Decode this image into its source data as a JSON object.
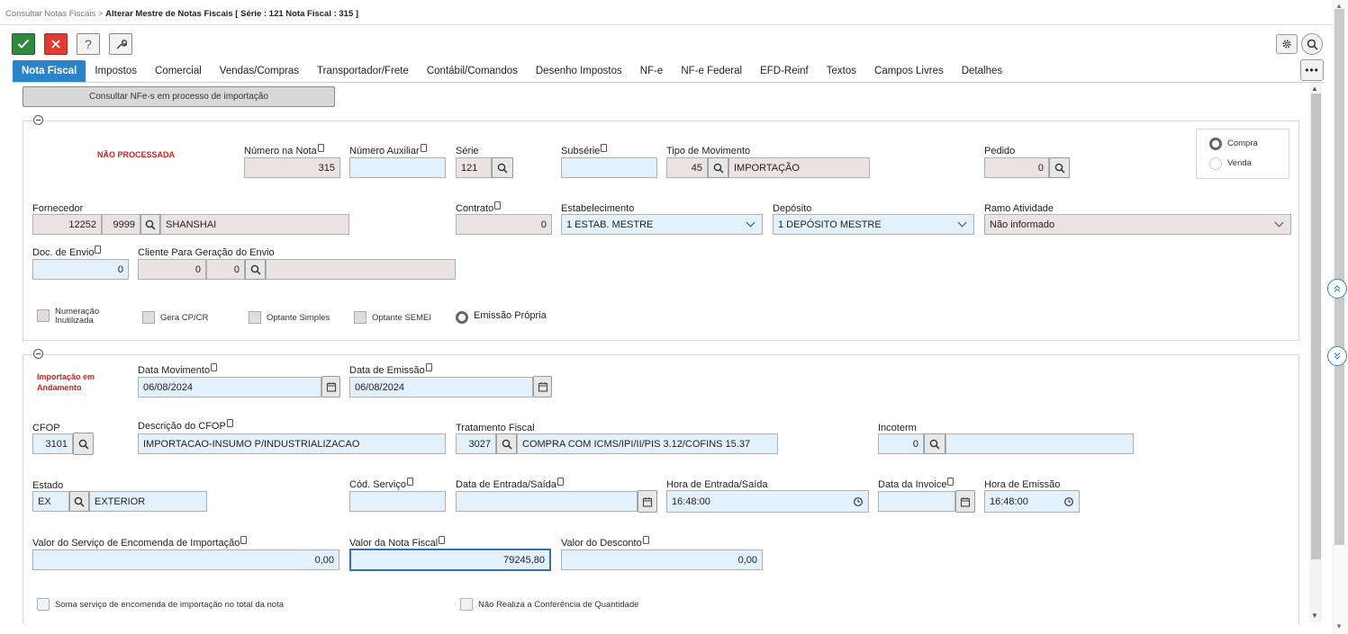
{
  "breadcrumb": {
    "parent": "Consultar Notas Fiscais",
    "separator": ">",
    "current": "Alterar Mestre de Notas Fiscais [ Série : 121 Nota Fiscal : 315 ]"
  },
  "toolbar": {
    "help_label": "?"
  },
  "tabs": [
    "Nota Fiscal",
    "Impostos",
    "Comercial",
    "Vendas/Compras",
    "Transportador/Frete",
    "Contábil/Comandos",
    "Desenho Impostos",
    "NF-e",
    "NF-e Federal",
    "EFD-Reinf",
    "Textos",
    "Campos Livres",
    "Detalhes"
  ],
  "consult_button": "Consultar NFe-s em processo de importação",
  "section1": {
    "status": "NÃO PROCESSADA",
    "numero_nota": {
      "label": "Número na Nota",
      "value": "315"
    },
    "numero_auxiliar": {
      "label": "Número Auxiliar",
      "value": ""
    },
    "serie": {
      "label": "Série",
      "value": "121"
    },
    "subserie": {
      "label": "Subsérie",
      "value": ""
    },
    "tipo_movimento": {
      "label": "Tipo de Movimento",
      "code": "45",
      "desc": "IMPORTAÇÃO"
    },
    "pedido": {
      "label": "Pedido",
      "value": "0"
    },
    "radio": {
      "compra": "Compra",
      "venda": "Venda"
    },
    "fornecedor": {
      "label": "Fornecedor",
      "code": "12252",
      "code2": "9999",
      "name": "SHANSHAI"
    },
    "contrato": {
      "label": "Contrato",
      "value": "0"
    },
    "estabelecimento": {
      "label": "Estabelecimento",
      "value": "1 ESTAB. MESTRE"
    },
    "deposito": {
      "label": "Depósito",
      "value": "1 DEPÓSITO MESTRE"
    },
    "ramo": {
      "label": "Ramo Atividade",
      "value": "Não informado"
    },
    "doc_envio": {
      "label": "Doc. de Envio",
      "value": "0"
    },
    "cliente_envio": {
      "label": "Cliente Para Geração do Envio",
      "code": "0",
      "code2": "0",
      "name": ""
    },
    "checks": {
      "numeracao_1": "Numeração",
      "numeracao_2": "Inutilizada",
      "gera": "Gera CP/CR",
      "simples": "Optante Simples",
      "semei": "Optante SEMEI",
      "emissao": "Emissão Própria"
    }
  },
  "section2": {
    "status_1": "Importação em",
    "status_2": "Andamento",
    "data_movimento": {
      "label": "Data Movimento",
      "value": "06/08/2024"
    },
    "data_emissao": {
      "label": "Data de Emissão",
      "value": "06/08/2024"
    },
    "cfop": {
      "label": "CFOP",
      "value": "3101"
    },
    "desc_cfop": {
      "label": "Descrição do CFOP",
      "value": "IMPORTACAO-INSUMO P/INDUSTRIALIZACAO"
    },
    "tratamento": {
      "label": "Tratamento Fiscal",
      "code": "3027",
      "desc": "COMPRA COM ICMS/IPI/II/PIS 3.12/COFINS 15.37"
    },
    "incoterm": {
      "label": "Incoterm",
      "code": "0",
      "desc": ""
    },
    "estado": {
      "label": "Estado",
      "code": "EX",
      "name": "EXTERIOR"
    },
    "cod_servico": {
      "label": "Cód. Serviço",
      "value": ""
    },
    "data_entrada": {
      "label": "Data de Entrada/Saída",
      "value": ""
    },
    "hora_entrada": {
      "label": "Hora de Entrada/Saída",
      "value": "16:48:00"
    },
    "data_invoice": {
      "label": "Data da Invoice",
      "value": ""
    },
    "hora_emissao": {
      "label": "Hora de Emissão",
      "value": "16:48:00"
    },
    "valor_servico": {
      "label": "Valor do Serviço de Encomenda de Importação",
      "value": "0,00"
    },
    "valor_nota": {
      "label": "Valor da Nota Fiscal",
      "value": "79245,80"
    },
    "valor_desconto": {
      "label": "Valor do Desconto",
      "value": "0,00"
    },
    "check_soma": "Soma serviço de encomenda de importação no total da nota",
    "check_conf": "Não Realiza a Conferência de Quantidade"
  }
}
